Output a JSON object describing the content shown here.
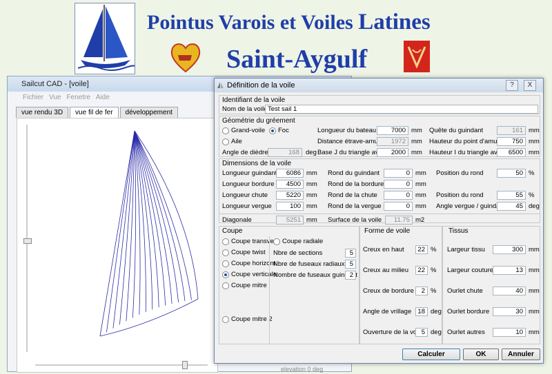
{
  "banner": {
    "title_part1": "Pointus Varois et Voiles",
    "title_part2": "Latines",
    "subtitle": "Saint-Aygulf"
  },
  "back_window": {
    "title": "Sailcut CAD - [voile]",
    "menu": [
      "Fichier",
      "Vue",
      "Fenetre",
      "Aide"
    ],
    "tabs": [
      "vue rendu 3D",
      "vue fil de fer",
      "développement"
    ],
    "active_tab": 1,
    "status_label": "elevation",
    "status_value": "0 deg"
  },
  "dialog": {
    "title": "Définition de la voile",
    "help_btn": "?",
    "close_btn": "X",
    "ident": {
      "section": "Identifiant de la voile",
      "name_label": "Nom de la voile",
      "name_value": "Test sail 1"
    },
    "rig": {
      "section": "Géométrie du gréement",
      "radio_grandvoile": "Grand-voile",
      "radio_foc": "Foc",
      "radio_aile": "Aile",
      "dihedral_label": "Angle de dièdre",
      "dihedral_value": "168",
      "dihedral_unit": "deg",
      "boat_length_label": "Longueur du bateau",
      "boat_length_value": "7000",
      "boat_length_unit": "mm",
      "stem_dist_label": "Distance étrave-amure",
      "stem_dist_value": "1972",
      "stem_dist_unit": "mm",
      "base_j_label": "Base J du triangle avant",
      "base_j_value": "2000",
      "base_j_unit": "mm",
      "luff_rake_label": "Quête du guindant",
      "luff_rake_value": "161",
      "luff_rake_unit": "mm",
      "tack_height_label": "Hauteur du point d'amure",
      "tack_height_value": "750",
      "tack_height_unit": "mm",
      "height_i_label": "Hauteur I du triangle avant",
      "height_i_value": "6500",
      "height_i_unit": "mm"
    },
    "dims": {
      "section": "Dimensions de la voile",
      "rows": [
        {
          "label": "Longueur guindant",
          "value": "6086",
          "unit": "mm",
          "round_label": "Rond du guindant",
          "round_value": "0",
          "round_unit": "mm",
          "pos_label": "Position du rond",
          "pos_value": "50",
          "pos_unit": "%"
        },
        {
          "label": "Longueur bordure",
          "value": "4500",
          "unit": "mm",
          "round_label": "Rond de la bordure",
          "round_value": "0",
          "round_unit": "mm"
        },
        {
          "label": "Longueur chute",
          "value": "5220",
          "unit": "mm",
          "round_label": "Rond de la chute",
          "round_value": "0",
          "round_unit": "mm",
          "pos_label": "Position du rond",
          "pos_value": "55",
          "pos_unit": "%"
        },
        {
          "label": "Longueur vergue",
          "value": "100",
          "unit": "mm",
          "round_label": "Rond de la vergue",
          "round_value": "0",
          "round_unit": "mm",
          "pos_label": "Angle vergue / guindant",
          "pos_value": "45",
          "pos_unit": "deg"
        }
      ],
      "diag_label": "Diagonale",
      "diag_value": "5251",
      "diag_unit": "mm",
      "area_label": "Surface de la voile",
      "area_value": "11.75",
      "area_unit": "m2"
    },
    "cut": {
      "section": "Coupe",
      "options": [
        "Coupe transver",
        "Coupe twist",
        "Coupe horizont",
        "Coupe verticale",
        "Coupe mitre",
        "Coupe mitre 2"
      ],
      "selected": 3,
      "radial": "Coupe radiale",
      "sections_label": "Nbre de sections",
      "sections_value": "5",
      "gores_label": "Nbre de fuseaux radiaux",
      "gores_value": "5",
      "luff_gores_label": "Nombre de fuseaux guindant",
      "luff_gores_value": "2"
    },
    "shape": {
      "section": "Forme de voile",
      "rows": [
        {
          "label": "Creux en haut",
          "value": "22",
          "unit": "%"
        },
        {
          "label": "Creux au milieu",
          "value": "22",
          "unit": "%"
        },
        {
          "label": "Creux de bordure",
          "value": "2",
          "unit": "%"
        },
        {
          "label": "Angle de vrillage",
          "value": "18",
          "unit": "deg"
        },
        {
          "label": "Ouverture de la voile",
          "value": "5",
          "unit": "deg"
        }
      ]
    },
    "cloth": {
      "section": "Tissus",
      "rows": [
        {
          "label": "Largeur tissu",
          "value": "300",
          "unit": "mm"
        },
        {
          "label": "Largeur coutures",
          "value": "13",
          "unit": "mm"
        },
        {
          "label": "Ourlet chute",
          "value": "40",
          "unit": "mm"
        },
        {
          "label": "Ourlet bordure",
          "value": "30",
          "unit": "mm"
        },
        {
          "label": "Ourlet autres",
          "value": "10",
          "unit": "mm"
        }
      ]
    },
    "buttons": {
      "compute": "Calculer",
      "ok": "OK",
      "cancel": "Annuler"
    }
  }
}
